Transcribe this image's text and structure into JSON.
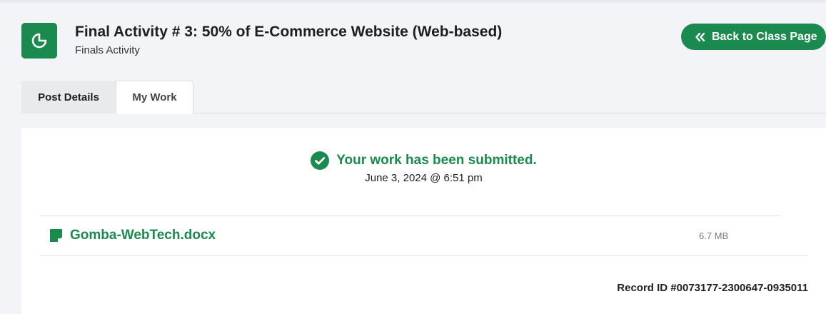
{
  "header": {
    "title": "Final Activity # 3: 50% of E-Commerce Website (Web-based)",
    "subtitle": "Finals Activity",
    "icon": "pie-chart-icon",
    "back_button_label": "Back to Class Page",
    "back_button_icon": "double-chevron-left-icon"
  },
  "tabs": [
    {
      "label": "Post Details",
      "active": false
    },
    {
      "label": "My Work",
      "active": true
    }
  ],
  "submission": {
    "status_text": "Your work has been submitted.",
    "status_icon": "check-circle-icon",
    "submitted_at": "June 3, 2024 @ 6:51 pm",
    "files": [
      {
        "name": "Gomba-WebTech.docx",
        "size": "6.7 MB",
        "icon": "document-icon"
      }
    ],
    "record_id": "Record ID #0073177-2300647-0935011"
  },
  "colors": {
    "accent": "#1a8a4f",
    "background": "#f3f4f8",
    "card": "#ffffff"
  }
}
